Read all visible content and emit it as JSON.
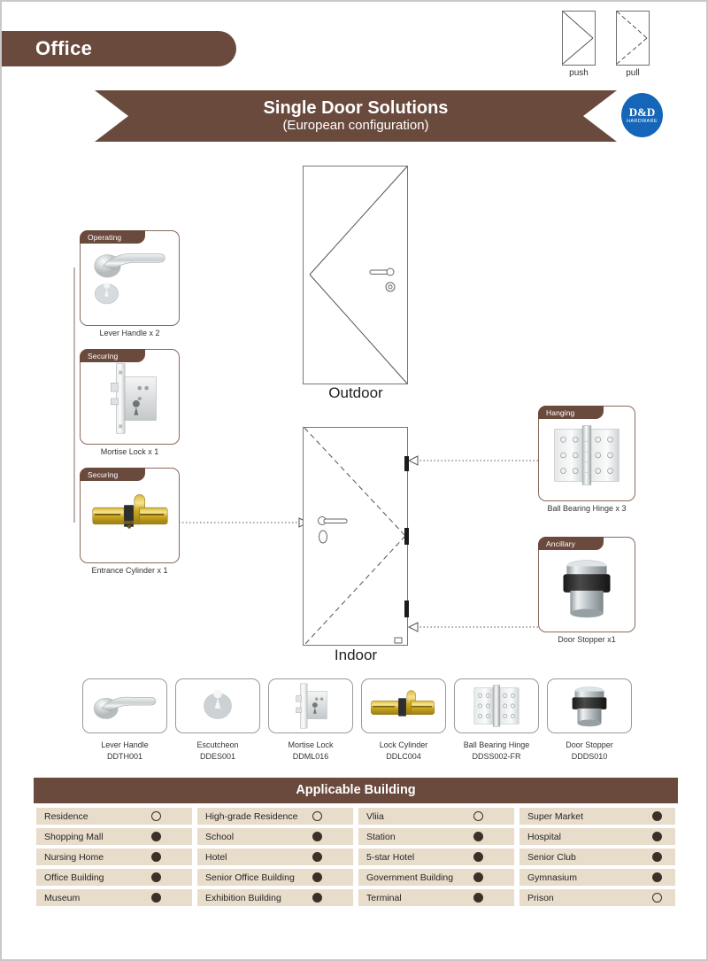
{
  "header": {
    "category_label": "Office",
    "title": "Single Door Solutions",
    "subtitle": "(European configuration)",
    "logo_primary": "D&D",
    "logo_secondary": "HARDWARE",
    "brand_brown": "#6B4A3E",
    "brand_blue": "#1565B8",
    "row_beige": "#E8DCCB"
  },
  "door_symbols": [
    {
      "name": "push",
      "label": "push",
      "style": "solid"
    },
    {
      "name": "pull",
      "label": "pull",
      "style": "dashed"
    }
  ],
  "doors": [
    {
      "name": "outdoor-door",
      "caption": "Outdoor"
    },
    {
      "name": "indoor-door",
      "caption": "Indoor"
    }
  ],
  "left_cards": [
    {
      "tag": "Operating",
      "caption": "Lever Handle x 2",
      "icon": "lever-handle"
    },
    {
      "tag": "Securing",
      "caption": "Mortise Lock x 1",
      "icon": "mortise-lock"
    },
    {
      "tag": "Securing",
      "caption": "Entrance Cylinder x 1",
      "icon": "cylinder"
    }
  ],
  "right_cards": [
    {
      "tag": "Hanging",
      "caption": "Ball Bearing Hinge x 3",
      "icon": "hinge"
    },
    {
      "tag": "Ancillary",
      "caption": "Door Stopper x1",
      "icon": "door-stopper"
    }
  ],
  "products": [
    {
      "name": "Lever Handle",
      "code": "DDTH001",
      "icon": "lever-handle"
    },
    {
      "name": "Escutcheon",
      "code": "DDES001",
      "icon": "escutcheon"
    },
    {
      "name": "Mortise Lock",
      "code": "DDML016",
      "icon": "mortise-lock"
    },
    {
      "name": "Lock Cylinder",
      "code": "DDLC004",
      "icon": "cylinder"
    },
    {
      "name": "Ball Bearing Hinge",
      "code": "DDSS002-FR",
      "icon": "hinge"
    },
    {
      "name": "Door Stopper",
      "code": "DDDS010",
      "icon": "door-stopper"
    }
  ],
  "applicable_building": {
    "title": "Applicable Building",
    "items": [
      {
        "label": "Residence",
        "applicable": false
      },
      {
        "label": "High-grade Residence",
        "applicable": false
      },
      {
        "label": "Vliia",
        "applicable": false
      },
      {
        "label": "Super Market",
        "applicable": true
      },
      {
        "label": "Shopping Mall",
        "applicable": true
      },
      {
        "label": "School",
        "applicable": true
      },
      {
        "label": "Station",
        "applicable": true
      },
      {
        "label": "Hospital",
        "applicable": true
      },
      {
        "label": "Nursing Home",
        "applicable": true
      },
      {
        "label": "Hotel",
        "applicable": true
      },
      {
        "label": "5-star Hotel",
        "applicable": true
      },
      {
        "label": "Senior Club",
        "applicable": true
      },
      {
        "label": "Office Building",
        "applicable": true
      },
      {
        "label": "Senior Office Building",
        "applicable": true
      },
      {
        "label": "Government Building",
        "applicable": true
      },
      {
        "label": "Gymnasium",
        "applicable": true
      },
      {
        "label": "Museum",
        "applicable": true
      },
      {
        "label": "Exhibition Building",
        "applicable": true
      },
      {
        "label": "Terminal",
        "applicable": true
      },
      {
        "label": "Prison",
        "applicable": false
      }
    ]
  }
}
